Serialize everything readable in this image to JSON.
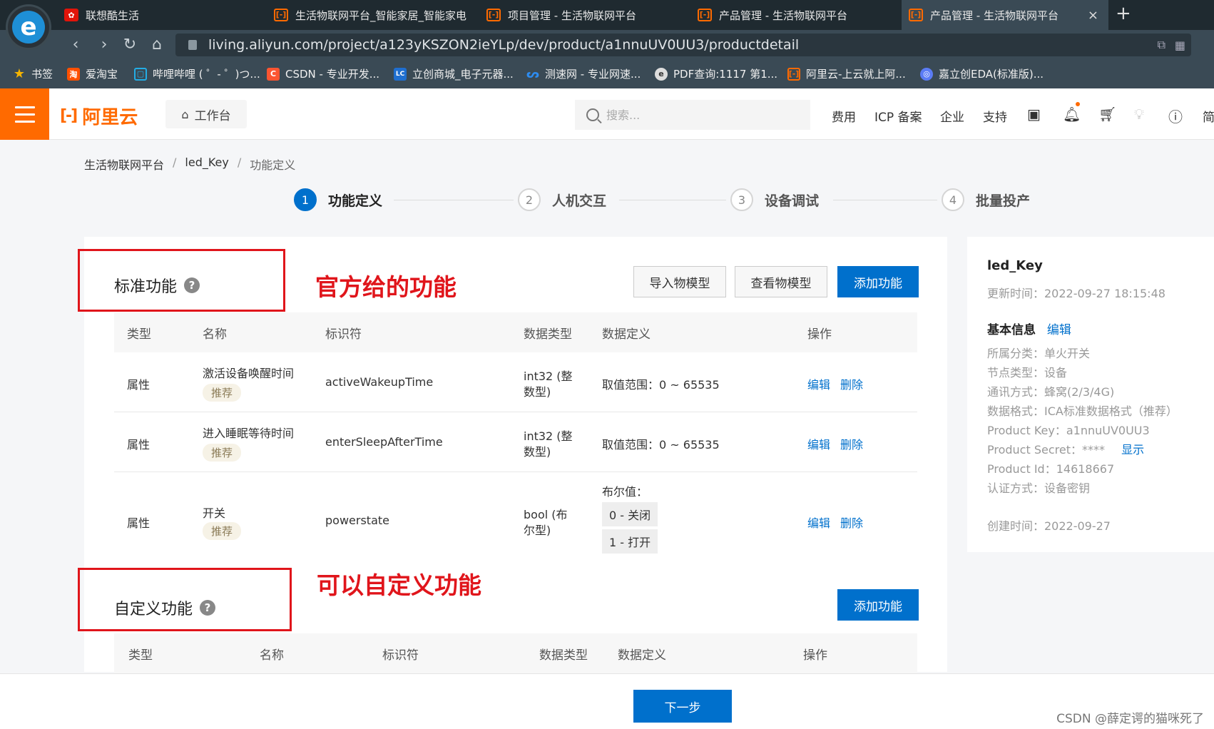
{
  "browser": {
    "tabs": [
      {
        "label": "联想酷生活",
        "favicon": "lenovo-icon"
      },
      {
        "label": "生活物联网平台_智能家居_智能家电",
        "favicon": "aliyun-icon"
      },
      {
        "label": "项目管理 - 生活物联网平台",
        "favicon": "aliyun-icon"
      },
      {
        "label": "产品管理 - 生活物联网平台",
        "favicon": "aliyun-icon"
      },
      {
        "label": "产品管理 - 生活物联网平台",
        "favicon": "aliyun-icon",
        "active": true
      }
    ],
    "close_glyph": "×",
    "newtab_glyph": "+",
    "url": "living.aliyun.com/project/a123yKSZON2ieYLp/dev/product/a1nnuUV0UU3/productdetail",
    "bookmarks": [
      {
        "label": "书签",
        "icon": "star-icon"
      },
      {
        "label": "爱淘宝",
        "icon": "taobao-icon"
      },
      {
        "label": "哔哩哔哩 ( ゜- ゜)つ...",
        "icon": "bilibili-icon"
      },
      {
        "label": "CSDN - 专业开发...",
        "icon": "csdn-icon"
      },
      {
        "label": "立创商城_电子元器...",
        "icon": "lcsc-icon"
      },
      {
        "label": "测速网 - 专业网速...",
        "icon": "speedtest-icon"
      },
      {
        "label": "PDF查询:1117 第1...",
        "icon": "pdf-icon"
      },
      {
        "label": "阿里云-上云就上阿...",
        "icon": "aliyun-icon"
      },
      {
        "label": "嘉立创EDA(标准版)...",
        "icon": "eda-icon"
      }
    ]
  },
  "header": {
    "logo_text": "阿里云",
    "workbench": "工作台",
    "search_placeholder": "搜索...",
    "links": [
      "费用",
      "ICP 备案",
      "企业",
      "支持"
    ],
    "overflow_text": "简",
    "accent_color": "#ff6a00"
  },
  "breadcrumb": [
    "生活物联网平台",
    "led_Key",
    "功能定义"
  ],
  "steps": [
    {
      "num": "1",
      "label": "功能定义",
      "active": true
    },
    {
      "num": "2",
      "label": "人机交互"
    },
    {
      "num": "3",
      "label": "设备调试"
    },
    {
      "num": "4",
      "label": "批量投产"
    }
  ],
  "standard": {
    "title": "标准功能",
    "annotation": "官方给的功能",
    "buttons": {
      "import": "导入物模型",
      "view": "查看物模型",
      "add": "添加功能"
    },
    "columns": [
      "类型",
      "名称",
      "标识符",
      "数据类型",
      "数据定义",
      "操作"
    ],
    "rows": [
      {
        "type": "属性",
        "name": "激活设备唤醒时间",
        "tag": "推荐",
        "id": "activeWakeupTime",
        "dtype1": "int32 (整",
        "dtype2": "数型)",
        "def": "取值范围：0 ~ 65535",
        "edit": "编辑",
        "del": "删除"
      },
      {
        "type": "属性",
        "name": "进入睡眠等待时间",
        "tag": "推荐",
        "id": "enterSleepAfterTime",
        "dtype1": "int32 (整",
        "dtype2": "数型)",
        "def": "取值范围：0 ~ 65535",
        "edit": "编辑",
        "del": "删除"
      },
      {
        "type": "属性",
        "name": "开关",
        "tag": "推荐",
        "id": "powerstate",
        "dtype1": "bool (布",
        "dtype2": "尔型)",
        "def": "布尔值：",
        "enum0": "0 - 关闭",
        "enum1": "1 - 打开",
        "edit": "编辑",
        "del": "删除"
      }
    ]
  },
  "custom": {
    "title": "自定义功能",
    "annotation": "可以自定义功能",
    "add": "添加功能",
    "columns": [
      "类型",
      "名称",
      "标识符",
      "数据类型",
      "数据定义",
      "操作"
    ]
  },
  "product": {
    "name": "led_Key",
    "updated": "更新时间：2022-09-27 18:15:48",
    "basic_title": "基本信息",
    "edit": "编辑",
    "info": [
      "所属分类：单火开关",
      "节点类型：设备",
      "通讯方式：蜂窝(2/3/4G)",
      "数据格式：ICA标准数据格式（推荐）",
      "Product Key：a1nnuUV0UU3",
      "Product Secret：****",
      "Product Id：14618667",
      "认证方式：设备密钥"
    ],
    "show": "显示",
    "created": "创建时间：2022-09-27"
  },
  "footer": {
    "next": "下一步",
    "watermark": "CSDN @薛定谔的猫咪死了"
  }
}
